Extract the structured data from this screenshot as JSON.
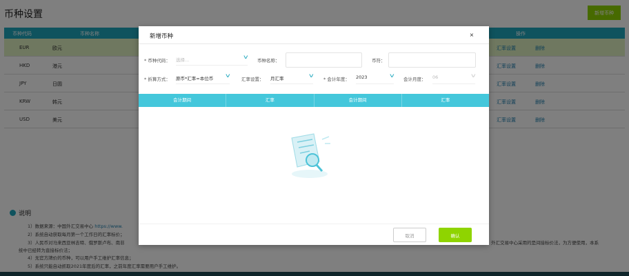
{
  "page": {
    "title": "币种设置",
    "add_button": "新增币种"
  },
  "table": {
    "headers": [
      "币种代码",
      "币种名称",
      "操作"
    ],
    "rows": [
      {
        "code": "EUR",
        "name": "欧元",
        "op1": "汇率设置",
        "op2": "删除"
      },
      {
        "code": "HKD",
        "name": "港元",
        "op1": "汇率设置",
        "op2": "删除"
      },
      {
        "code": "JPY",
        "name": "日圆",
        "op1": "汇率设置",
        "op2": "删除"
      },
      {
        "code": "KRW",
        "name": "韩元",
        "op1": "汇率设置",
        "op2": "删除"
      },
      {
        "code": "USD",
        "name": "美元",
        "op1": "汇率设置",
        "op2": "删除"
      }
    ]
  },
  "notes": {
    "heading": "说明",
    "l1": "1）数据来源：中国外汇交易中心 ",
    "l1_link": "https://www.",
    "l2": "2）系统自动获取每月第一个工作日的汇率标价；",
    "l3": "3）人民币对马来西亚林吉特、俄罗斯卢布、南非",
    "l3_right": "外汇交易中心采用的是间接标价法，为方便使用，本系",
    "l3_cont": "统中已经转为直接标价法；",
    "l4": "4）无官方牌价的币种，可以用户手工维护汇率信息；",
    "l5": "5）系统只能自动抓取2021年度后的汇率，之前年度汇率需要用户手工维护。"
  },
  "modal": {
    "title": "新增币种",
    "close": "×",
    "currency_code_label": "* 币种代码：",
    "currency_code_placeholder": "选择...",
    "currency_name_label": "币种名称：",
    "symbol_label": "币符：",
    "conversion_label": "* 折算方式：",
    "conversion_value": "原币*汇率=本位币",
    "rate_setting_label": "汇率设置：",
    "rate_setting_value": "月汇率",
    "year_label": "* 会计年度：",
    "year_value": "2023",
    "month_label": "会计月度：",
    "month_value": "06",
    "table_headers": [
      "会计期间",
      "汇率",
      "会计期间",
      "汇率"
    ],
    "cancel": "取消",
    "confirm": "确认"
  },
  "colors": {
    "teal": "#1fa7bd",
    "green": "#8fd400",
    "header_light": "#44c7db"
  }
}
